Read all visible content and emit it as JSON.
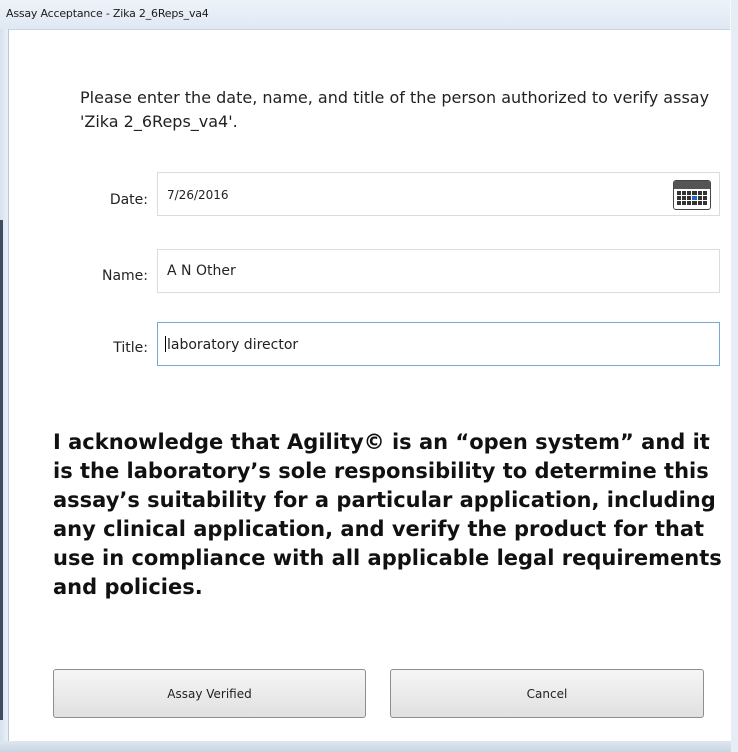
{
  "window": {
    "title": "Assay Acceptance - Zika 2_6Reps_va4"
  },
  "prompt": {
    "text": "Please enter the date, name, and title of the person authorized to verify assay 'Zika 2_6Reps_va4'."
  },
  "form": {
    "date": {
      "label": "Date:",
      "value": "7/26/2016",
      "icon": "calendar-icon"
    },
    "name": {
      "label": "Name:",
      "value": "A N Other"
    },
    "title": {
      "label": "Title:",
      "value": "laboratory director"
    }
  },
  "acknowledgement": {
    "text": "I acknowledge that Agility© is an “open system” and it is the laboratory’s sole responsibility to determine this assay’s suitability for a particular application, including any clinical application, and verify the product for that use in compliance with all applicable legal requirements and policies."
  },
  "buttons": {
    "verify": "Assay Verified",
    "cancel": "Cancel"
  },
  "colors": {
    "focus_border": "#7aa7d6",
    "titlebar": "#dfe8f3"
  }
}
